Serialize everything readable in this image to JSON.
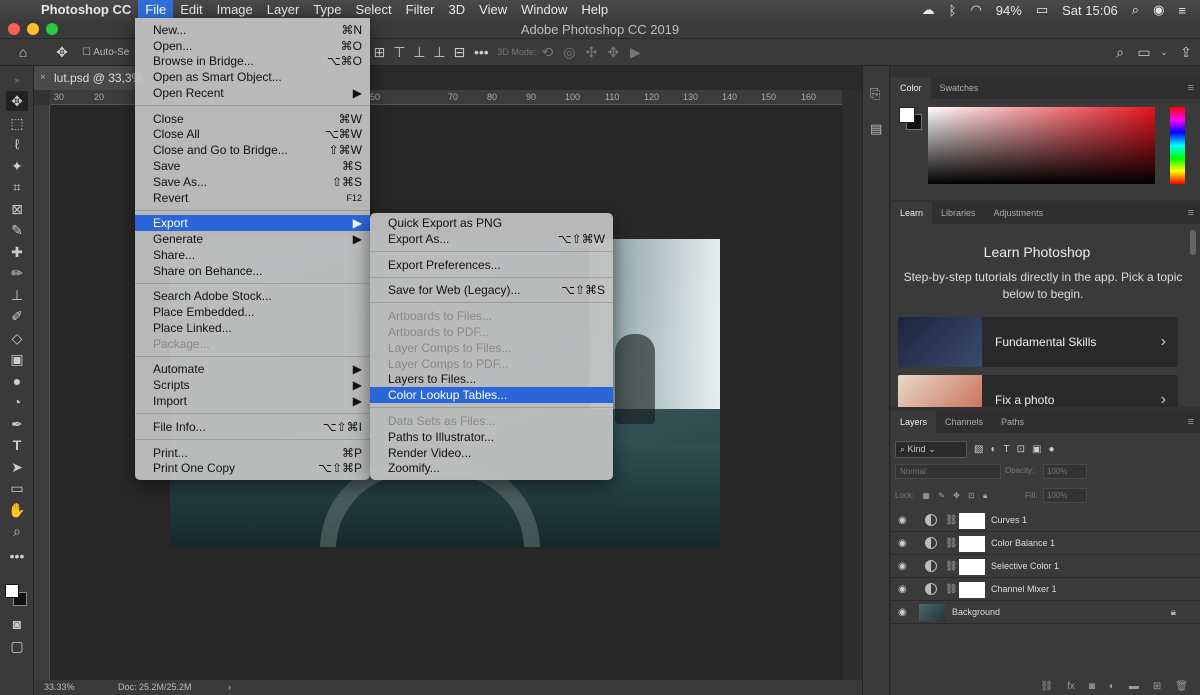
{
  "menubar": {
    "app": "Photoshop CC",
    "items": [
      "File",
      "Edit",
      "Image",
      "Layer",
      "Type",
      "Select",
      "Filter",
      "3D",
      "View",
      "Window",
      "Help"
    ],
    "active": "File",
    "battery": "94%",
    "clock": "Sat 15:06"
  },
  "window": {
    "title": "Adobe Photoshop CC 2019"
  },
  "options": {
    "auto_select": "Auto-Se",
    "mode_3d": "3D Mode:"
  },
  "document": {
    "tab": "lut.psd @ 33,3% (",
    "ruler_labels": [
      "30",
      "20",
      "50",
      "70",
      "80",
      "90",
      "100",
      "110",
      "120",
      "130",
      "140",
      "150",
      "160"
    ],
    "zoom": "33.33%",
    "doc_size": "Doc: 25.2M/25.2M"
  },
  "file_menu": {
    "items": [
      {
        "label": "New...",
        "shortcut": "⌘N"
      },
      {
        "label": "Open...",
        "shortcut": "⌘O"
      },
      {
        "label": "Browse in Bridge...",
        "shortcut": "⌥⌘O"
      },
      {
        "label": "Open as Smart Object...",
        "shortcut": ""
      },
      {
        "label": "Open Recent",
        "shortcut": "▶"
      },
      {
        "label": "Close",
        "shortcut": "⌘W"
      },
      {
        "label": "Close All",
        "shortcut": "⌥⌘W"
      },
      {
        "label": "Close and Go to Bridge...",
        "shortcut": "⇧⌘W"
      },
      {
        "label": "Save",
        "shortcut": "⌘S"
      },
      {
        "label": "Save As...",
        "shortcut": "⇧⌘S"
      },
      {
        "label": "Revert",
        "shortcut": "F12"
      },
      {
        "label": "Export",
        "shortcut": "▶"
      },
      {
        "label": "Generate",
        "shortcut": "▶"
      },
      {
        "label": "Share...",
        "shortcut": ""
      },
      {
        "label": "Share on Behance...",
        "shortcut": ""
      },
      {
        "label": "Search Adobe Stock...",
        "shortcut": ""
      },
      {
        "label": "Place Embedded...",
        "shortcut": ""
      },
      {
        "label": "Place Linked...",
        "shortcut": ""
      },
      {
        "label": "Package...",
        "shortcut": ""
      },
      {
        "label": "Automate",
        "shortcut": "▶"
      },
      {
        "label": "Scripts",
        "shortcut": "▶"
      },
      {
        "label": "Import",
        "shortcut": "▶"
      },
      {
        "label": "File Info...",
        "shortcut": "⌥⇧⌘I"
      },
      {
        "label": "Print...",
        "shortcut": "⌘P"
      },
      {
        "label": "Print One Copy",
        "shortcut": "⌥⇧⌘P"
      }
    ]
  },
  "export_menu": {
    "items": [
      {
        "label": "Quick Export as PNG",
        "shortcut": ""
      },
      {
        "label": "Export As...",
        "shortcut": "⌥⇧⌘W"
      },
      {
        "label": "Export Preferences...",
        "shortcut": ""
      },
      {
        "label": "Save for Web (Legacy)...",
        "shortcut": "⌥⇧⌘S"
      },
      {
        "label": "Artboards to Files...",
        "shortcut": ""
      },
      {
        "label": "Artboards to PDF...",
        "shortcut": ""
      },
      {
        "label": "Layer Comps to Files...",
        "shortcut": ""
      },
      {
        "label": "Layer Comps to PDF...",
        "shortcut": ""
      },
      {
        "label": "Layers to Files...",
        "shortcut": ""
      },
      {
        "label": "Color Lookup Tables...",
        "shortcut": ""
      },
      {
        "label": "Data Sets as Files...",
        "shortcut": ""
      },
      {
        "label": "Paths to Illustrator...",
        "shortcut": ""
      },
      {
        "label": "Render Video...",
        "shortcut": ""
      },
      {
        "label": "Zoomify...",
        "shortcut": ""
      }
    ]
  },
  "color_panel": {
    "tabs": [
      "Color",
      "Swatches"
    ],
    "accent": "#e8141e"
  },
  "learn_panel": {
    "tabs": [
      "Learn",
      "Libraries",
      "Adjustments"
    ],
    "title": "Learn Photoshop",
    "subtitle": "Step-by-step tutorials directly in the app. Pick a topic below to begin.",
    "cards": [
      "Fundamental Skills",
      "Fix a photo"
    ]
  },
  "layers_panel": {
    "tabs": [
      "Layers",
      "Channels",
      "Paths"
    ],
    "kind": "Kind",
    "blend_mode": "Normal",
    "opacity_label": "Opacity:",
    "opacity_value": "100%",
    "lock_label": "Lock:",
    "fill_label": "Fill:",
    "fill_value": "100%",
    "layers": [
      "Curves 1",
      "Color Balance 1",
      "Selective Color 1",
      "Channel Mixer 1",
      "Background"
    ]
  }
}
